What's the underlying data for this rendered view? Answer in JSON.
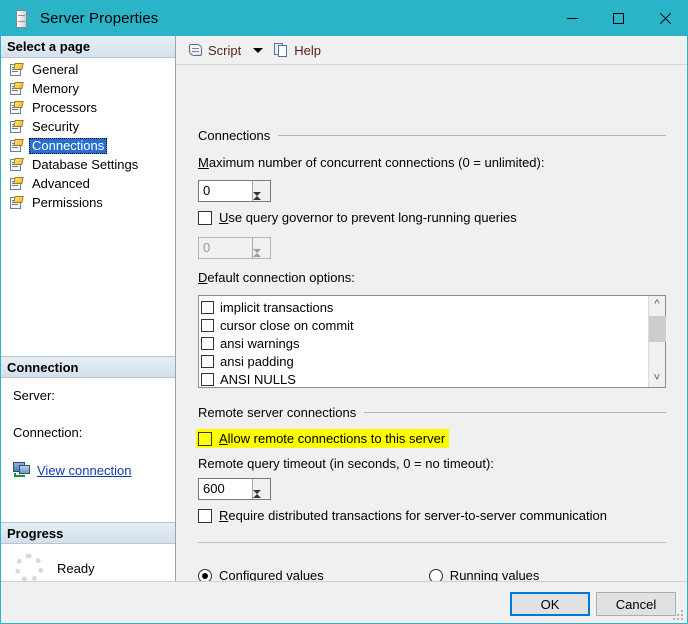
{
  "window": {
    "title": "Server Properties",
    "icon": "server-icon",
    "controls": {
      "minimize": "minimize-icon",
      "maximize": "maximize-icon",
      "close": "close-icon"
    },
    "titlebar_color": "#2bb3c8"
  },
  "sidebar": {
    "header": "Select a page",
    "pages": [
      {
        "label": "General",
        "selected": false
      },
      {
        "label": "Memory",
        "selected": false
      },
      {
        "label": "Processors",
        "selected": false
      },
      {
        "label": "Security",
        "selected": false
      },
      {
        "label": "Connections",
        "selected": true
      },
      {
        "label": "Database Settings",
        "selected": false
      },
      {
        "label": "Advanced",
        "selected": false
      },
      {
        "label": "Permissions",
        "selected": false
      }
    ],
    "connection": {
      "header": "Connection",
      "server_label": "Server:",
      "server_value": "",
      "connection_label": "Connection:",
      "connection_value": "",
      "view_connection_link": "View connection "
    },
    "progress": {
      "header": "Progress",
      "status": "Ready"
    }
  },
  "toolbar": {
    "script_label": "Script",
    "help_label": "Help"
  },
  "main": {
    "connections_group": {
      "title": "Connections",
      "max_connections_label": "Maximum number of concurrent connections (0 = unlimited):",
      "max_connections_value": "0",
      "query_governor_label": "Use query governor to prevent long-running queries",
      "query_governor_checked": false,
      "query_governor_cost_value": "0",
      "default_options_label": "Default connection options:",
      "options": [
        {
          "label": "implicit transactions",
          "checked": false
        },
        {
          "label": "cursor close on commit",
          "checked": false
        },
        {
          "label": "ansi warnings",
          "checked": false
        },
        {
          "label": "ansi padding",
          "checked": false
        },
        {
          "label": "ANSI NULLS",
          "checked": false
        }
      ]
    },
    "remote_group": {
      "title": "Remote server connections",
      "allow_remote_label": "Allow remote connections to this server",
      "allow_remote_checked": false,
      "allow_remote_highlight_color": "#ffff00",
      "remote_timeout_label": "Remote query timeout (in seconds, 0 = no timeout):",
      "remote_timeout_value": "600",
      "require_dtc_label": "Require distributed transactions for server-to-server communication",
      "require_dtc_checked": false
    },
    "value_mode": {
      "configured_label": "Configured values",
      "running_label": "Running values",
      "selected": "configured"
    }
  },
  "footer": {
    "ok_label": "OK",
    "cancel_label": "Cancel"
  }
}
